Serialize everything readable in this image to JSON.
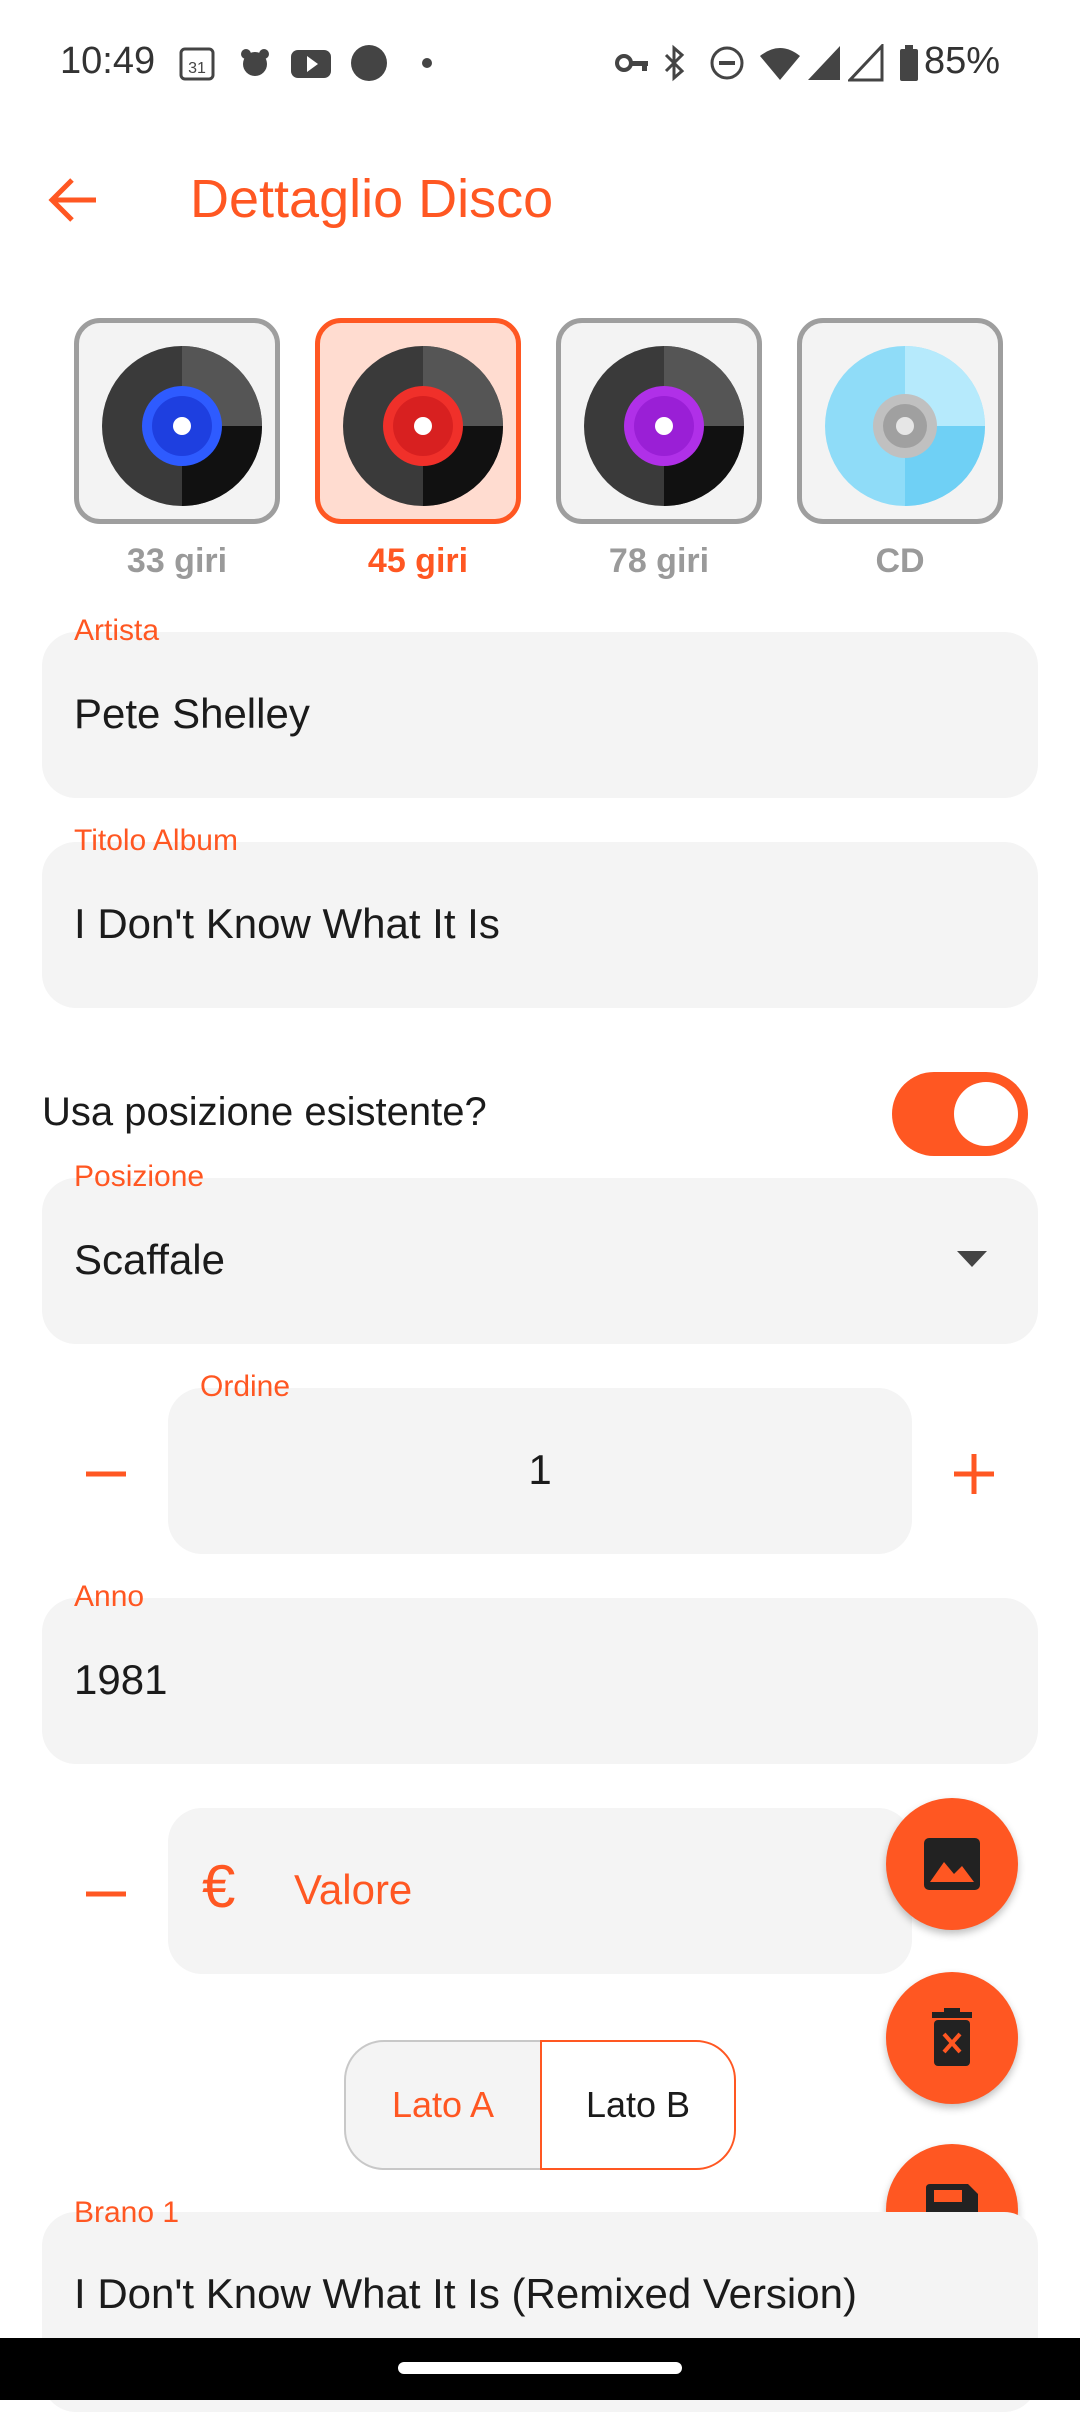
{
  "status_bar": {
    "time": "10:49",
    "battery": "85%"
  },
  "app_bar": {
    "title": "Dettaglio Disco"
  },
  "formats": [
    {
      "label": "33 giri",
      "selected": false,
      "center_color": "#2e5bff"
    },
    {
      "label": "45 giri",
      "selected": true,
      "center_color": "#f0302a"
    },
    {
      "label": "78 giri",
      "selected": false,
      "center_color": "#b030e8"
    },
    {
      "label": "CD",
      "selected": false,
      "center_color": "#c0c0c0"
    }
  ],
  "fields": {
    "artista": {
      "label": "Artista",
      "value": "Pete Shelley"
    },
    "titolo": {
      "label": "Titolo Album",
      "value": "I Don't Know What It Is"
    },
    "posizione_toggle": {
      "label": "Usa posizione esistente?",
      "on": true
    },
    "posizione": {
      "label": "Posizione",
      "value": "Scaffale"
    },
    "ordine": {
      "label": "Ordine",
      "value": "1"
    },
    "anno": {
      "label": "Anno",
      "value": "1981"
    },
    "valore": {
      "placeholder": "Valore",
      "currency": "€"
    }
  },
  "sides": {
    "a": "Lato A",
    "b": "Lato B",
    "selected": "Lato B"
  },
  "track": {
    "label": "Brano 1",
    "value": "I Don't Know What It Is (Remixed Version)"
  },
  "colors": {
    "accent": "#ff5722",
    "field_bg": "#f4f4f4"
  },
  "icons": {
    "image": "image-icon",
    "delete": "delete-icon",
    "save": "save-icon"
  }
}
